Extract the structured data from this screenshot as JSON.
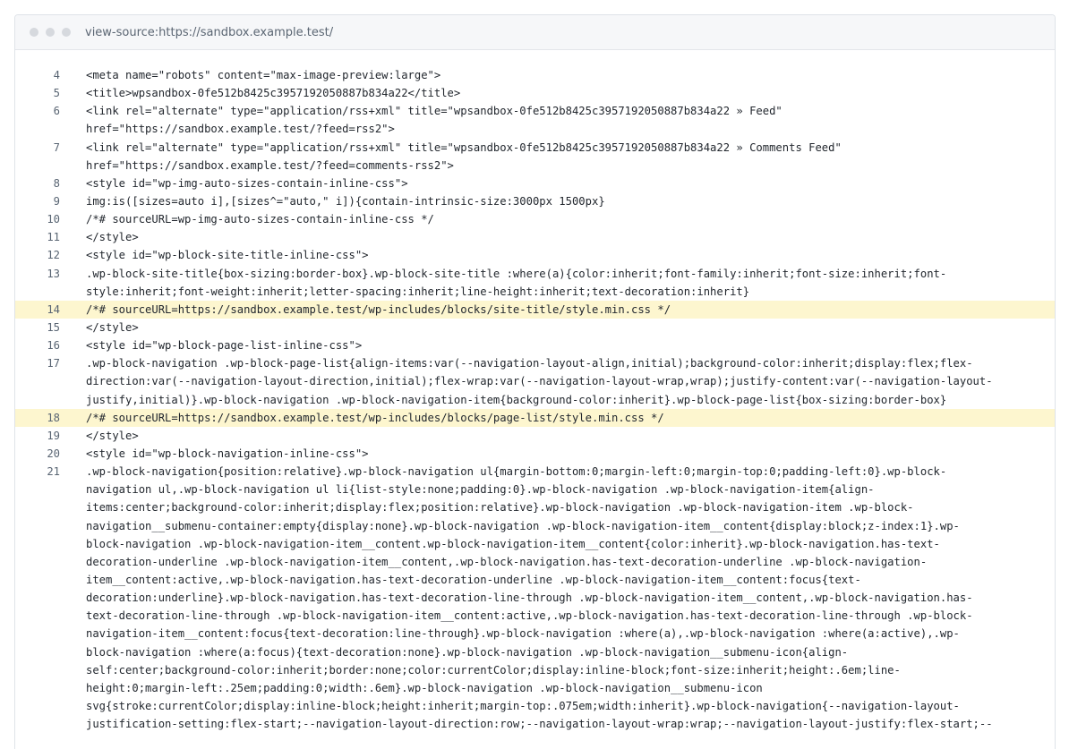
{
  "window": {
    "url": "view-source:https://sandbox.example.test/"
  },
  "source": {
    "lines": [
      {
        "num": "4",
        "highlighted": false,
        "rows": [
          "<meta name=\"robots\" content=\"max-image-preview:large\">"
        ]
      },
      {
        "num": "5",
        "highlighted": false,
        "rows": [
          "<title>wpsandbox-0fe512b8425c3957192050887b834a22</title>"
        ]
      },
      {
        "num": "6",
        "highlighted": false,
        "rows": [
          "<link rel=\"alternate\" type=\"application/rss+xml\" title=\"wpsandbox-0fe512b8425c3957192050887b834a22 » Feed\"",
          "href=\"https://sandbox.example.test/?feed=rss2\">"
        ]
      },
      {
        "num": "7",
        "highlighted": false,
        "rows": [
          "<link rel=\"alternate\" type=\"application/rss+xml\" title=\"wpsandbox-0fe512b8425c3957192050887b834a22 » Comments Feed\"",
          "href=\"https://sandbox.example.test/?feed=comments-rss2\">"
        ]
      },
      {
        "num": "8",
        "highlighted": false,
        "rows": [
          "<style id=\"wp-img-auto-sizes-contain-inline-css\">"
        ]
      },
      {
        "num": "9",
        "highlighted": false,
        "rows": [
          "img:is([sizes=auto i],[sizes^=\"auto,\" i]){contain-intrinsic-size:3000px 1500px}"
        ]
      },
      {
        "num": "10",
        "highlighted": false,
        "rows": [
          "/*# sourceURL=wp-img-auto-sizes-contain-inline-css */"
        ]
      },
      {
        "num": "11",
        "highlighted": false,
        "rows": [
          "</style>"
        ]
      },
      {
        "num": "12",
        "highlighted": false,
        "rows": [
          "<style id=\"wp-block-site-title-inline-css\">"
        ]
      },
      {
        "num": "13",
        "highlighted": false,
        "rows": [
          ".wp-block-site-title{box-sizing:border-box}.wp-block-site-title :where(a){color:inherit;font-family:inherit;font-size:inherit;font-",
          "style:inherit;font-weight:inherit;letter-spacing:inherit;line-height:inherit;text-decoration:inherit}"
        ]
      },
      {
        "num": "14",
        "highlighted": true,
        "rows": [
          "/*# sourceURL=https://sandbox.example.test/wp-includes/blocks/site-title/style.min.css */"
        ]
      },
      {
        "num": "15",
        "highlighted": false,
        "rows": [
          "</style>"
        ]
      },
      {
        "num": "16",
        "highlighted": false,
        "rows": [
          "<style id=\"wp-block-page-list-inline-css\">"
        ]
      },
      {
        "num": "17",
        "highlighted": false,
        "rows": [
          ".wp-block-navigation .wp-block-page-list{align-items:var(--navigation-layout-align,initial);background-color:inherit;display:flex;flex-",
          "direction:var(--navigation-layout-direction,initial);flex-wrap:var(--navigation-layout-wrap,wrap);justify-content:var(--navigation-layout-",
          "justify,initial)}.wp-block-navigation .wp-block-navigation-item{background-color:inherit}.wp-block-page-list{box-sizing:border-box}"
        ]
      },
      {
        "num": "18",
        "highlighted": true,
        "rows": [
          "/*# sourceURL=https://sandbox.example.test/wp-includes/blocks/page-list/style.min.css */"
        ]
      },
      {
        "num": "19",
        "highlighted": false,
        "rows": [
          "</style>"
        ]
      },
      {
        "num": "20",
        "highlighted": false,
        "rows": [
          "<style id=\"wp-block-navigation-inline-css\">"
        ]
      },
      {
        "num": "21",
        "highlighted": false,
        "rows": [
          ".wp-block-navigation{position:relative}.wp-block-navigation ul{margin-bottom:0;margin-left:0;margin-top:0;padding-left:0}.wp-block-",
          "navigation ul,.wp-block-navigation ul li{list-style:none;padding:0}.wp-block-navigation .wp-block-navigation-item{align-",
          "items:center;background-color:inherit;display:flex;position:relative}.wp-block-navigation .wp-block-navigation-item .wp-block-",
          "navigation__submenu-container:empty{display:none}.wp-block-navigation .wp-block-navigation-item__content{display:block;z-index:1}.wp-",
          "block-navigation .wp-block-navigation-item__content.wp-block-navigation-item__content{color:inherit}.wp-block-navigation.has-text-",
          "decoration-underline .wp-block-navigation-item__content,.wp-block-navigation.has-text-decoration-underline .wp-block-navigation-",
          "item__content:active,.wp-block-navigation.has-text-decoration-underline .wp-block-navigation-item__content:focus{text-",
          "decoration:underline}.wp-block-navigation.has-text-decoration-line-through .wp-block-navigation-item__content,.wp-block-navigation.has-",
          "text-decoration-line-through .wp-block-navigation-item__content:active,.wp-block-navigation.has-text-decoration-line-through .wp-block-",
          "navigation-item__content:focus{text-decoration:line-through}.wp-block-navigation :where(a),.wp-block-navigation :where(a:active),.wp-",
          "block-navigation :where(a:focus){text-decoration:none}.wp-block-navigation .wp-block-navigation__submenu-icon{align-",
          "self:center;background-color:inherit;border:none;color:currentColor;display:inline-block;font-size:inherit;height:.6em;line-",
          "height:0;margin-left:.25em;padding:0;width:.6em}.wp-block-navigation .wp-block-navigation__submenu-icon",
          "svg{stroke:currentColor;display:inline-block;height:inherit;margin-top:.075em;width:inherit}.wp-block-navigation{--navigation-layout-",
          "justification-setting:flex-start;--navigation-layout-direction:row;--navigation-layout-wrap:wrap;--navigation-layout-justify:flex-start;--"
        ]
      }
    ]
  }
}
